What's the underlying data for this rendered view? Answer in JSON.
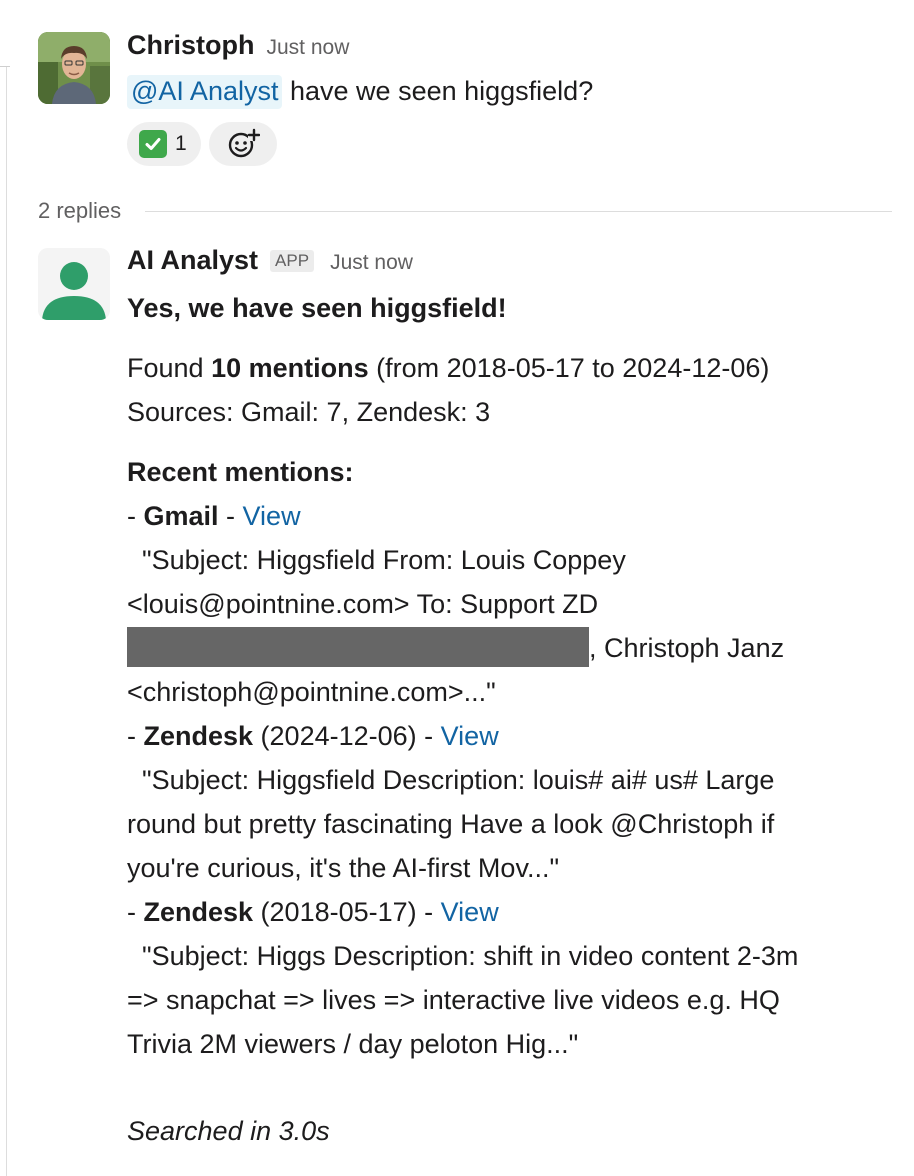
{
  "message_1": {
    "sender": "Christoph",
    "timestamp": "Just now",
    "mention": "@AI Analyst",
    "text": "have we seen higgsfield?",
    "reactions": [
      {
        "emoji": "check-mark-button",
        "count": "1"
      }
    ],
    "add_reaction_icon": "add-reaction-icon"
  },
  "thread": {
    "replies_label": "2 replies"
  },
  "message_2": {
    "sender": "AI Analyst",
    "badge": "APP",
    "timestamp": "Just now",
    "headline": "Yes, we have seen higgsfield!",
    "summary": {
      "found_prefix": "Found",
      "found_count": "10 mentions",
      "found_range": "(from 2018-05-17 to 2024-12-06)",
      "sources": "Sources: Gmail: 7, Zendesk: 3"
    },
    "recent_heading": "Recent mentions:",
    "mentions": [
      {
        "dash": "- ",
        "source": "Gmail",
        "date": "",
        "sep": " - ",
        "link": "View",
        "lines": [
          "  \"Subject: Higgsfield From: Louis Coppey",
          "<louis@pointnine.com> To: Support ZD",
          ", Christoph Janz",
          "<christoph@pointnine.com>...\""
        ]
      },
      {
        "dash": "- ",
        "source": "Zendesk",
        "date": " (2024-12-06)",
        "sep": " - ",
        "link": "View",
        "lines": [
          "  \"Subject: Higgsfield Description: louis# ai# us# Large",
          "round but pretty fascinating Have a look @Christoph if",
          "you're curious, it's the AI-first Mov...\""
        ]
      },
      {
        "dash": "- ",
        "source": "Zendesk",
        "date": " (2018-05-17)",
        "sep": " - ",
        "link": "View",
        "lines": [
          "  \"Subject: Higgs Description: shift in video content 2-3m",
          "=> snapchat => lives => interactive live videos e.g. HQ",
          "Trivia 2M viewers / day peloton Hig...\""
        ]
      }
    ],
    "footer": "Searched in 3.0s"
  }
}
